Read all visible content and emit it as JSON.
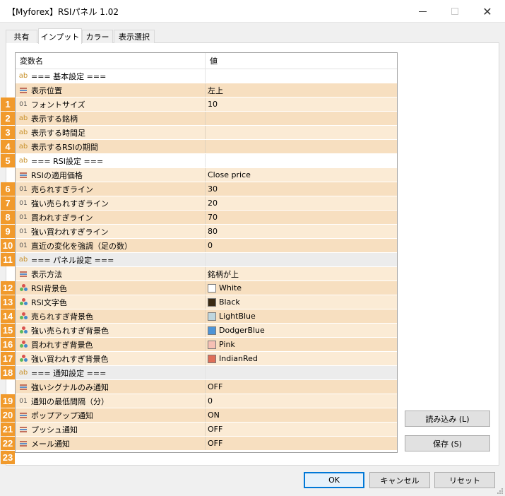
{
  "window": {
    "title": "【Myforex】RSIパネル 1.02"
  },
  "tabs": [
    "共有",
    "インプット",
    "カラー",
    "表示選択"
  ],
  "grid": {
    "header_name": "変数名",
    "header_value": "値"
  },
  "rows": [
    {
      "kind": "section",
      "name": "=== 基本設定 ===",
      "value": "",
      "type": "ab",
      "badge": ""
    },
    {
      "kind": "row",
      "name": "表示位置",
      "value": "左上",
      "type": "list",
      "badge": "1"
    },
    {
      "kind": "row",
      "name": "フォントサイズ",
      "value": "10",
      "type": "01",
      "badge": "2"
    },
    {
      "kind": "row",
      "name": "表示する銘柄",
      "value": "",
      "type": "ab",
      "badge": "3"
    },
    {
      "kind": "row",
      "name": "表示する時間足",
      "value": "",
      "type": "ab",
      "badge": "4"
    },
    {
      "kind": "row",
      "name": "表示するRSIの期間",
      "value": "",
      "type": "ab",
      "badge": "5"
    },
    {
      "kind": "section",
      "name": "=== RSI設定 ===",
      "value": "",
      "type": "ab",
      "badge": ""
    },
    {
      "kind": "row",
      "name": "RSIの適用価格",
      "value": "Close price",
      "type": "list",
      "badge": "6"
    },
    {
      "kind": "row",
      "name": "売られすぎライン",
      "value": "30",
      "type": "01",
      "badge": "7"
    },
    {
      "kind": "row",
      "name": "強い売られすぎライン",
      "value": "20",
      "type": "01",
      "badge": "8"
    },
    {
      "kind": "row",
      "name": "買われすぎライン",
      "value": "70",
      "type": "01",
      "badge": "9"
    },
    {
      "kind": "row",
      "name": "強い買われすぎライン",
      "value": "80",
      "type": "01",
      "badge": "10"
    },
    {
      "kind": "row",
      "name": "直近の変化を強調（足の数）",
      "value": "0",
      "type": "01",
      "badge": "11"
    },
    {
      "kind": "section",
      "name": "=== パネル設定 ===",
      "value": "",
      "type": "ab",
      "badge": "",
      "gray": true
    },
    {
      "kind": "row",
      "name": "表示方法",
      "value": "銘柄が上",
      "type": "list",
      "badge": "12"
    },
    {
      "kind": "row",
      "name": "RSI背景色",
      "value": "White",
      "type": "color",
      "badge": "13",
      "swatch": "#ffffff"
    },
    {
      "kind": "row",
      "name": "RSI文字色",
      "value": "Black",
      "type": "color",
      "badge": "14",
      "swatch": "#3a2a14"
    },
    {
      "kind": "row",
      "name": "売られすぎ背景色",
      "value": "LightBlue",
      "type": "color",
      "badge": "15",
      "swatch": "#bfd6de"
    },
    {
      "kind": "row",
      "name": "強い売られすぎ背景色",
      "value": "DodgerBlue",
      "type": "color",
      "badge": "16",
      "swatch": "#4e94d6"
    },
    {
      "kind": "row",
      "name": "買われすぎ背景色",
      "value": "Pink",
      "type": "color",
      "badge": "17",
      "swatch": "#f6c0b4"
    },
    {
      "kind": "row",
      "name": "強い買われすぎ背景色",
      "value": "IndianRed",
      "type": "color",
      "badge": "18",
      "swatch": "#df6e58"
    },
    {
      "kind": "section",
      "name": "=== 通知設定 ===",
      "value": "",
      "type": "ab",
      "badge": "",
      "gray": true
    },
    {
      "kind": "row",
      "name": "強いシグナルのみ通知",
      "value": "OFF",
      "type": "list",
      "badge": "19"
    },
    {
      "kind": "row",
      "name": "通知の最低間隔（分）",
      "value": "0",
      "type": "01",
      "badge": "20"
    },
    {
      "kind": "row",
      "name": "ポップアップ通知",
      "value": "ON",
      "type": "list",
      "badge": "21"
    },
    {
      "kind": "row",
      "name": "プッシュ通知",
      "value": "OFF",
      "type": "list",
      "badge": "22"
    },
    {
      "kind": "row",
      "name": "メール通知",
      "value": "OFF",
      "type": "list",
      "badge": "23"
    }
  ],
  "side_buttons": {
    "load": "読み込み (L)",
    "save": "保存 (S)"
  },
  "footer_buttons": {
    "ok": "OK",
    "cancel": "キャンセル",
    "reset": "リセット"
  },
  "colors": {
    "badge": "#f19a2c",
    "row_odd": "#f7dfc0",
    "row_even": "#fbebd5",
    "accent": "#0078d7"
  }
}
